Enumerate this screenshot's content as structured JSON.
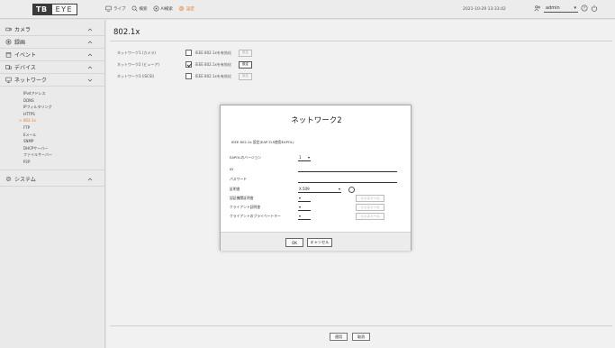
{
  "header": {
    "logo_tb": "TB",
    "logo_eye": "EYE",
    "nav": [
      {
        "label": "ライブ",
        "icon": "monitor-icon"
      },
      {
        "label": "検索",
        "icon": "search-icon"
      },
      {
        "label": "AI検索",
        "icon": "ai-search-icon"
      },
      {
        "label": "設定",
        "icon": "gear-icon"
      }
    ],
    "datetime": "2021-10-29 13:33:42",
    "user": "admin",
    "icons": [
      "users-icon",
      "help-icon",
      "power-icon"
    ]
  },
  "sidebar": {
    "menus": [
      {
        "label": "カメラ",
        "icon": "camera-icon"
      },
      {
        "label": "録画",
        "icon": "record-icon"
      },
      {
        "label": "イベント",
        "icon": "event-icon"
      },
      {
        "label": "デバイス",
        "icon": "device-icon"
      },
      {
        "label": "ネットワーク",
        "icon": "network-icon"
      },
      {
        "label": "システム",
        "icon": "system-icon"
      }
    ],
    "network_items": [
      "IPv4アドレス",
      "DDNS",
      "IPフィルタリング",
      "HTTPS",
      "802.1x",
      "FTP",
      "Eメール",
      "SNMP",
      "DHCPサーバー",
      "ファイルサーバー",
      "P2P"
    ],
    "active_item": "802.1x"
  },
  "main": {
    "title": "802.1x",
    "rows": [
      {
        "label": "ネットワーク1 (カメラ)",
        "checkbox_label": "IEEE 802.1xを有効化",
        "checked": false,
        "button": "設定",
        "enabled": false
      },
      {
        "label": "ネットワーク2 (ビューア)",
        "checkbox_label": "IEEE 802.1xを有効化",
        "checked": true,
        "button": "設定",
        "enabled": true
      },
      {
        "label": "ネットワーク3 (iSCSI)",
        "checkbox_label": "IEEE 802.1xを有効化",
        "checked": false,
        "button": "設定",
        "enabled": false
      }
    ],
    "apply_label": "適用",
    "cancel_label": "取消"
  },
  "dialog": {
    "title": "ネットワーク2",
    "description": "IEEE 802.1x 設定(EAP-TLS使用EAPOL)",
    "fields": {
      "eapol_version_label": "EAPOLのバージョン",
      "eapol_version_value": "1",
      "id_label": "ID",
      "id_value": "",
      "password_label": "パスワード",
      "password_value": "",
      "cert_label": "証明書",
      "cert_value": "X.509",
      "ca_cert_label": "認証機関証明書",
      "client_cert_label": "クライアント証明書",
      "client_key_label": "クライアントのプライベートキー",
      "install_label": "インストール"
    },
    "ok_label": "OK",
    "cancel_label": "キャンセル"
  }
}
